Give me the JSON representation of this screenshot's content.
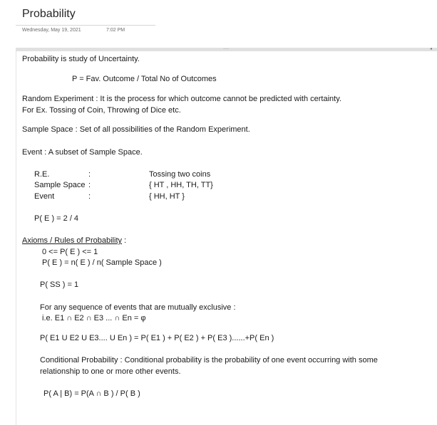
{
  "page": {
    "title": "Probability",
    "date": "Wednesday, May 19, 2021",
    "time": "7:02 PM"
  },
  "note": {
    "grip_glyph": "····",
    "arrow_glyph": "◂",
    "intro": "Probability is study of Uncertainty.",
    "formula": "P =  Fav. Outcome / Total No of Outcomes",
    "random_experiment": "Random Experiment : It is the process for which outcome cannot be predicted with certainty.",
    "example": "For Ex.  Tossing of Coin, Throwing of Dice etc.",
    "sample_space": "Sample Space : Set of all possibilities of the Random Experiment.",
    "event": "Event : A subset of Sample Space.",
    "table": {
      "rows": [
        {
          "label": "R.E.",
          "sep": ":",
          "value": "Tossing  two coins"
        },
        {
          "label": "Sample Space",
          "sep": ":",
          "value": "{ HT , HH, TH, TT}"
        },
        {
          "label": "Event",
          "sep": ":",
          "value": "{ HH, HT }"
        }
      ]
    },
    "p_event": "P( E ) = 2 / 4",
    "axioms_heading": "Axioms / Rules of Probability",
    "axioms_colon": " :",
    "axiom1": "0  <= P( E ) <= 1",
    "axiom2": "P( E ) = n( E )  /  n( Sample Space )",
    "axiom3": "P( SS ) =  1",
    "mutually_exclusive": "For any sequence of events that are mutually exclusive :",
    "intersection": "i.e.  E1 ∩ E2 ∩ E3 ... ∩ En =  φ",
    "union": "P( E1 U E2 U E3.... U En )  = P( E1 ) + P( E2 ) + P( E3 )......+P( En )",
    "conditional_1": "Conditional Probability :  Conditional probability is the probability of one event occurring with some",
    "conditional_2": "relationship to one or more other events.",
    "conditional_formula": "P( A | B) = P(A ∩ B )  /  P( B )"
  }
}
